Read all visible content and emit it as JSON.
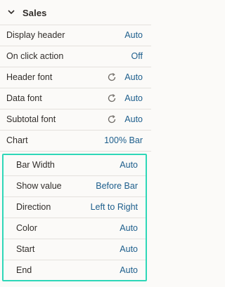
{
  "section": {
    "title": "Sales",
    "expand_icon": "chevron-down-icon"
  },
  "rows": [
    {
      "label": "Display header",
      "value": "Auto"
    },
    {
      "label": "On click action",
      "value": "Off"
    },
    {
      "label": "Header font",
      "value": "Auto",
      "icon": "reset-icon"
    },
    {
      "label": "Data font",
      "value": "Auto",
      "icon": "reset-icon"
    },
    {
      "label": "Subtotal font",
      "value": "Auto",
      "icon": "reset-icon"
    },
    {
      "label": "Chart",
      "value": "100% Bar"
    }
  ],
  "chart_options": [
    {
      "label": "Bar Width",
      "value": "Auto"
    },
    {
      "label": "Show value",
      "value": "Before Bar"
    },
    {
      "label": "Direction",
      "value": "Left to Right"
    },
    {
      "label": "Color",
      "value": "Auto"
    },
    {
      "label": "Start",
      "value": "Auto"
    },
    {
      "label": "End",
      "value": "Auto"
    }
  ],
  "colors": {
    "accent": "#1d5e8c",
    "highlight": "#2ed7b8",
    "text": "#312d2a"
  }
}
